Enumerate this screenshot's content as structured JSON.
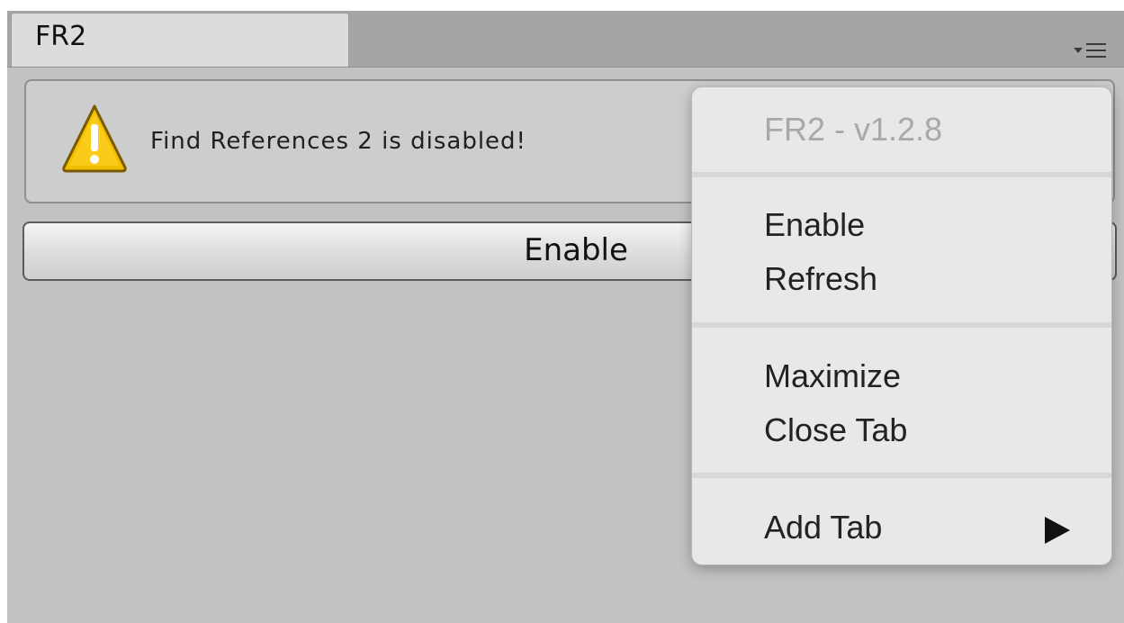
{
  "window": {
    "tab_title": "FR2",
    "tab_menu_icon": "tab-options-menu-icon"
  },
  "help_box": {
    "icon": "warning-icon",
    "message": "Find References 2 is disabled!"
  },
  "enable_button": {
    "label": "Enable"
  },
  "context_menu": {
    "header": "FR2 - v1.2.8",
    "enable": "Enable",
    "refresh": "Refresh",
    "maximize": "Maximize",
    "close_tab": "Close Tab",
    "add_tab": "Add Tab",
    "submenu_icon": "submenu-arrow-icon"
  },
  "colors": {
    "panel_bg": "#c2c2c2",
    "tabbar_bg": "#a5a5a5",
    "menu_bg": "#e8e8e8",
    "warning_yellow": "#f5c400"
  }
}
